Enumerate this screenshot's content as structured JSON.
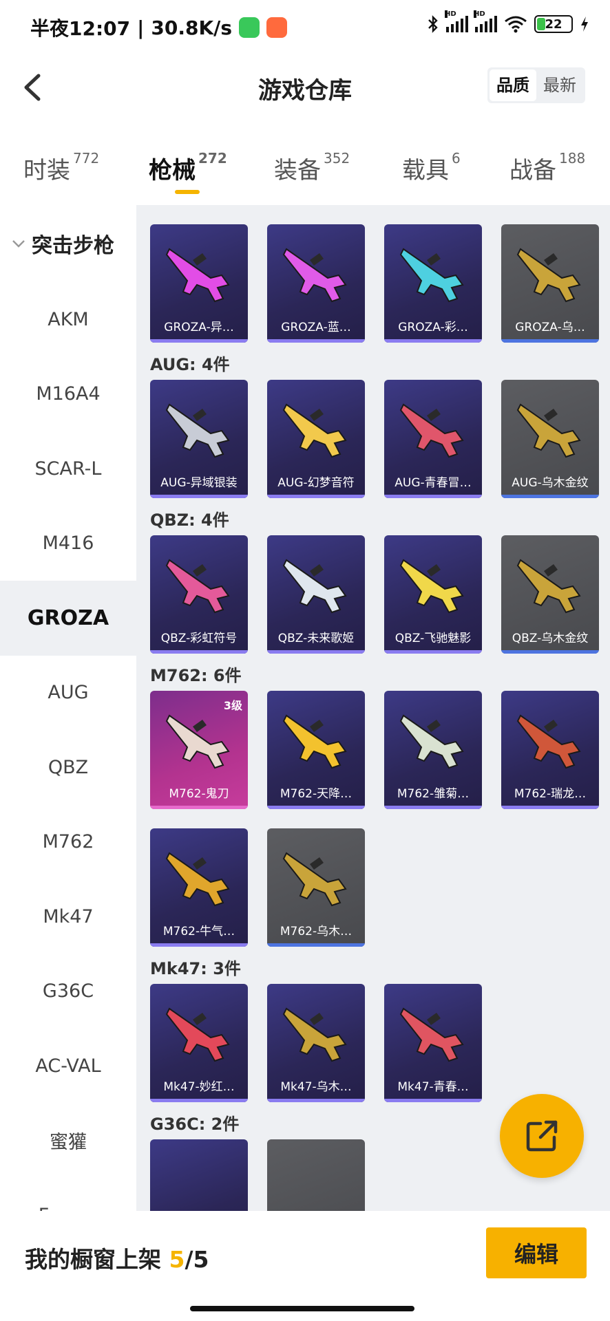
{
  "status_bar": {
    "time": "半夜12:07",
    "net_speed": "30.8K/s",
    "battery": "22",
    "signal_label_1": "HD",
    "signal_label_2": "HD"
  },
  "header": {
    "title": "游戏仓库",
    "sort_options": [
      "品质",
      "最新"
    ],
    "sort_active": "品质"
  },
  "tabs": [
    {
      "label": "时装",
      "count": "772"
    },
    {
      "label": "枪械",
      "count": "272"
    },
    {
      "label": "装备",
      "count": "352"
    },
    {
      "label": "载具",
      "count": "6"
    },
    {
      "label": "战备",
      "count": "188"
    }
  ],
  "sidebar": {
    "group": "突击步枪",
    "items": [
      "AKM",
      "M16A4",
      "SCAR-L",
      "M416",
      "GROZA",
      "AUG",
      "QBZ",
      "M762",
      "Mk47",
      "G36C",
      "AC-VAL",
      "蜜獾",
      "Famas"
    ],
    "active": "GROZA"
  },
  "sections": [
    {
      "label": "",
      "items": [
        {
          "name": "GROZA-异…",
          "style": "purple",
          "color": "#e24de6"
        },
        {
          "name": "GROZA-蓝…",
          "style": "purple",
          "color": "#e05be8"
        },
        {
          "name": "GROZA-彩…",
          "style": "purple",
          "color": "#4ed0e0"
        },
        {
          "name": "GROZA-乌…",
          "style": "gray",
          "color": "#c9a43a"
        }
      ]
    },
    {
      "label": "AUG: 4件",
      "items": [
        {
          "name": "AUG-异域银装",
          "style": "purple",
          "color": "#c8ccd6"
        },
        {
          "name": "AUG-幻梦音符",
          "style": "purple",
          "color": "#f2c94c"
        },
        {
          "name": "AUG-青春冒…",
          "style": "purple",
          "color": "#e0566b"
        },
        {
          "name": "AUG-乌木金纹",
          "style": "gray",
          "color": "#c9a43a"
        }
      ]
    },
    {
      "label": "QBZ: 4件",
      "items": [
        {
          "name": "QBZ-彩虹符号",
          "style": "purple",
          "color": "#e45a9a"
        },
        {
          "name": "QBZ-未来歌姬",
          "style": "purple",
          "color": "#dfe6ee"
        },
        {
          "name": "QBZ-飞驰魅影",
          "style": "purple",
          "color": "#f0d84a"
        },
        {
          "name": "QBZ-乌木金纹",
          "style": "gray",
          "color": "#c9a43a"
        }
      ]
    },
    {
      "label": "M762: 6件",
      "items": [
        {
          "name": "M762-鬼刀",
          "style": "pink",
          "color": "#e9d9d0",
          "level": "3级"
        },
        {
          "name": "M762-天降…",
          "style": "purple",
          "color": "#f3c22e"
        },
        {
          "name": "M762-雏菊…",
          "style": "purple",
          "color": "#d9e2d1"
        },
        {
          "name": "M762-瑞龙…",
          "style": "purple",
          "color": "#d0573a"
        },
        {
          "name": "M762-牛气…",
          "style": "purple",
          "color": "#e0a62c"
        },
        {
          "name": "M762-乌木…",
          "style": "gray",
          "color": "#c9a43a"
        }
      ]
    },
    {
      "label": "Mk47: 3件",
      "items": [
        {
          "name": "Mk47-妙红…",
          "style": "purple",
          "color": "#e3495a"
        },
        {
          "name": "Mk47-乌木…",
          "style": "purple",
          "color": "#c9a43a"
        },
        {
          "name": "Mk47-青春…",
          "style": "purple",
          "color": "#e05561"
        }
      ]
    },
    {
      "label": "G36C: 2件",
      "items": []
    }
  ],
  "footer": {
    "label": "我的橱窗上架",
    "current": "5",
    "total": "/5",
    "edit_label": "编辑"
  },
  "accent_color": "#f7b100"
}
